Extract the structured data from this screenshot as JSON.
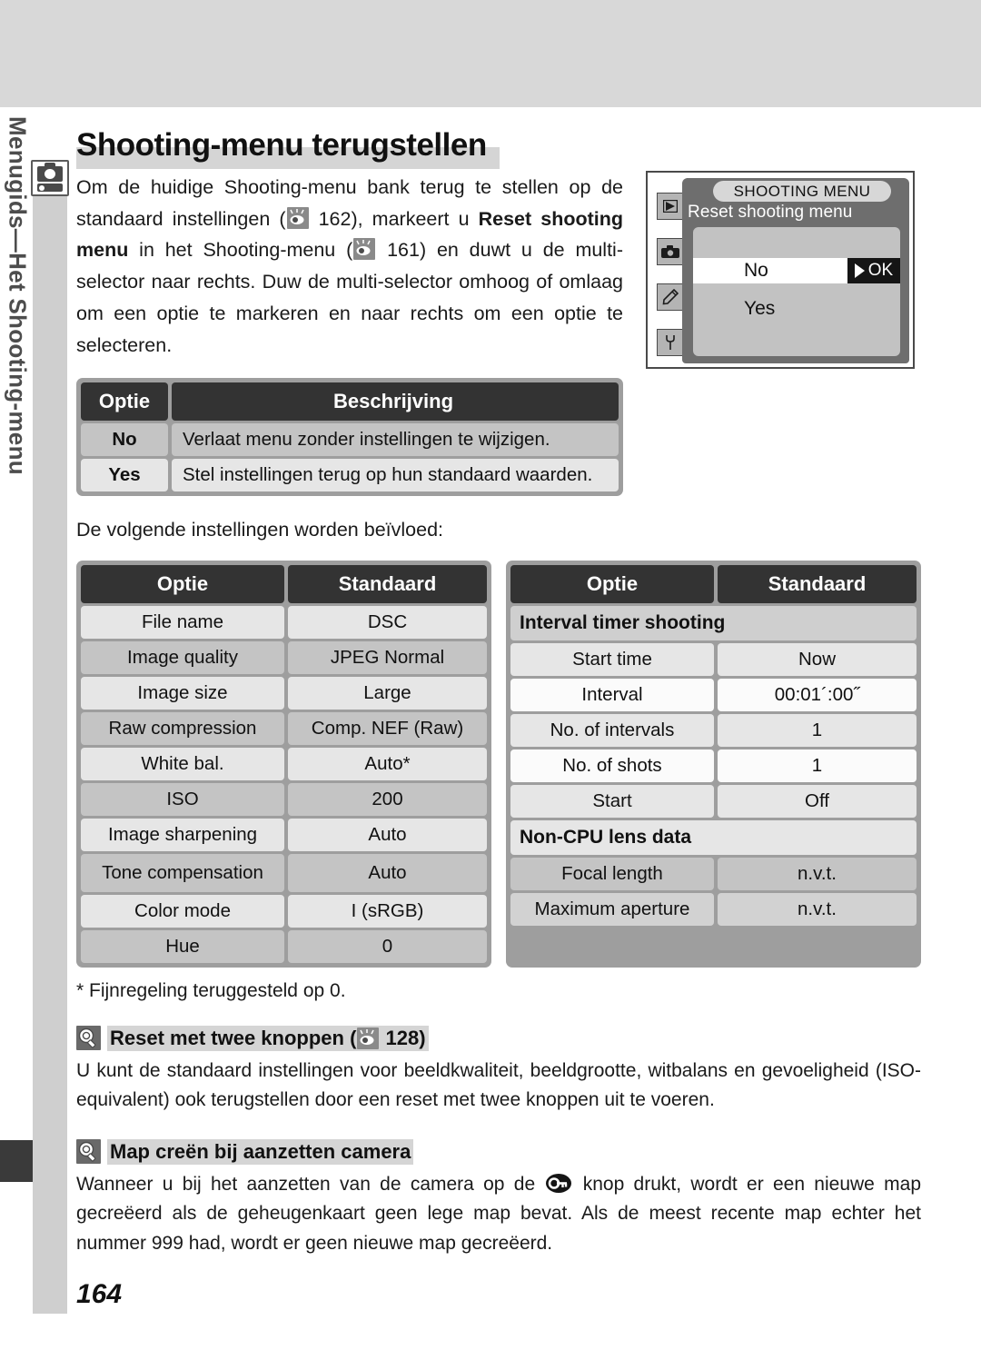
{
  "sidebar": {
    "label": "Menugids—Het Shooting-menu",
    "icon": "camera-icon"
  },
  "header": {
    "title": "Shooting-menu terugstellen"
  },
  "intro": {
    "part1": "Om de huidige Shooting-menu bank terug te stellen op de standaard instellingen (",
    "ref1_page": "162",
    "part2": "), markeert u ",
    "bold1": "Reset shooting menu",
    "part3": " in het Shooting-menu (",
    "ref2_page": "161",
    "part4": ") en duwt u de multi-selector naar rechts. Duw de multi-selector omhoog of omlaag om een optie te markeren en naar rechts om een optie te selecteren."
  },
  "lcd": {
    "title": "SHOOTING MENU",
    "subtitle": "Reset shooting menu",
    "option_no": "No",
    "ok_label": "OK",
    "option_yes": "Yes",
    "tabs": [
      "playback-tab-icon",
      "shooting-tab-icon",
      "custom-tab-icon",
      "setup-tab-icon"
    ]
  },
  "desc_table": {
    "headers": [
      "Optie",
      "Beschrijving"
    ],
    "rows": [
      {
        "option": "No",
        "description": "Verlaat menu zonder instellingen te wijzigen."
      },
      {
        "option": "Yes",
        "description": "Stel instellingen terug op hun standaard waarden."
      }
    ]
  },
  "lead_in": "De volgende instellingen worden beïvloed:",
  "left_table": {
    "headers": [
      "Optie",
      "Standaard"
    ],
    "rows": [
      {
        "option": "File name",
        "default": "DSC"
      },
      {
        "option": "Image quality",
        "default": "JPEG Normal"
      },
      {
        "option": "Image size",
        "default": "Large"
      },
      {
        "option": "Raw compression",
        "default": "Comp. NEF (Raw)"
      },
      {
        "option": "White bal.",
        "default": "Auto*"
      },
      {
        "option": "ISO",
        "default": "200"
      },
      {
        "option": "Image sharpening",
        "default": "Auto"
      },
      {
        "option": "Tone compensation",
        "default": "Auto"
      },
      {
        "option": "Color mode",
        "default": "I (sRGB)"
      },
      {
        "option": "Hue",
        "default": "0"
      }
    ]
  },
  "right_table": {
    "headers": [
      "Optie",
      "Standaard"
    ],
    "groups": [
      {
        "title": "Interval timer shooting",
        "rows": [
          {
            "option": "Start time",
            "default": "Now"
          },
          {
            "option": "Interval",
            "default": "00:01´:00˝"
          },
          {
            "option": "No. of intervals",
            "default": "1"
          },
          {
            "option": "No. of shots",
            "default": "1"
          },
          {
            "option": "Start",
            "default": "Off"
          }
        ]
      },
      {
        "title": "Non-CPU lens data",
        "rows": [
          {
            "option": "Focal length",
            "default": "n.v.t."
          },
          {
            "option": "Maximum aperture",
            "default": "n.v.t."
          }
        ]
      }
    ]
  },
  "footnote": "* Fijnregeling teruggesteld op 0.",
  "tips": [
    {
      "title": "Reset met twee knoppen (",
      "ref_page": "128",
      "title_end": ")",
      "body": "U kunt de standaard instellingen voor beeldkwaliteit, beeldgrootte, witbalans en gevoeligheid (ISO-equivalent) ook terugstellen door een reset met twee knoppen uit te voeren."
    }
  ],
  "tip2": {
    "title": "Map creën bij aanzetten camera",
    "body_part1": "Wanneer u bij het aanzetten van de camera op de ",
    "body_part2": " knop drukt, wordt er een nieuwe map gecreëerd als de geheugenkaart geen lege map bevat. Als de meest recente map echter het nummer 999 had, wordt er geen nieuwe map gecreëerd."
  },
  "page_number": "164",
  "colors": {
    "band": "#d8d8d8",
    "rail": "#cfcfcf",
    "table_frame": "#9e9e9e",
    "table_header": "#333333",
    "highlight": "#d5d5d5"
  }
}
